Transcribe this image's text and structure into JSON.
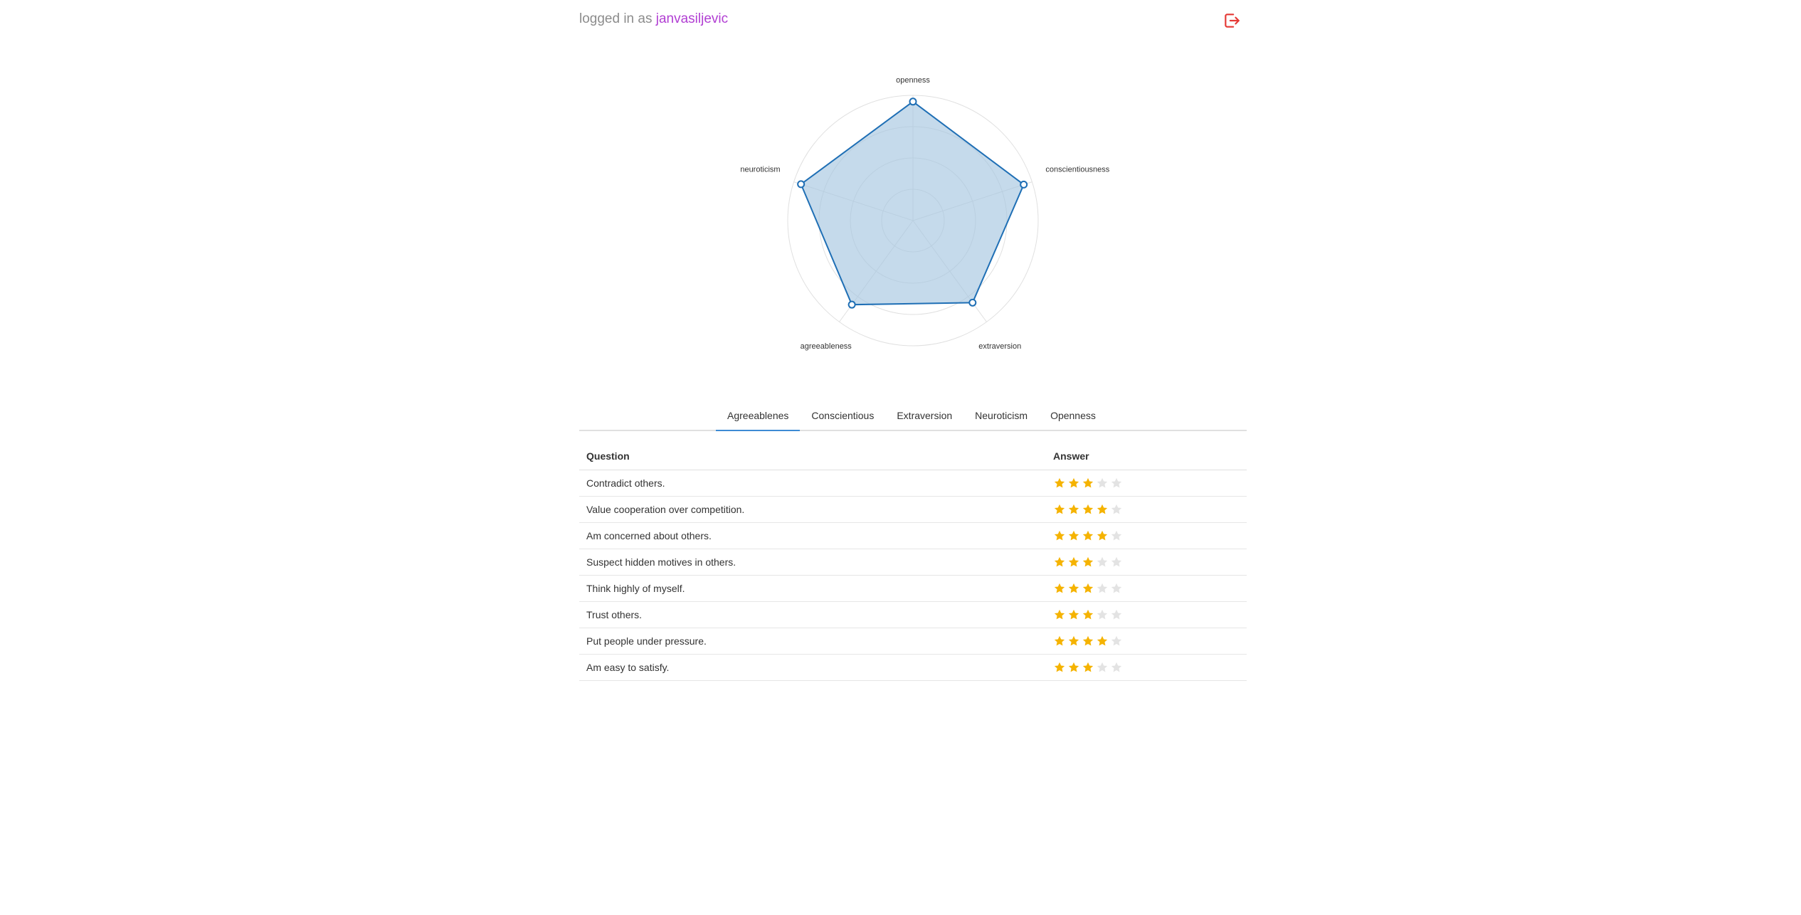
{
  "header": {
    "login_prefix": "logged in as",
    "username": "janvasiljevic",
    "logout_icon": "logout-icon"
  },
  "chart_data": {
    "type": "radar",
    "axes": [
      "openness",
      "conscientiousness",
      "extraversion",
      "agreeableness",
      "neuroticism"
    ],
    "series": [
      {
        "values": [
          0.95,
          0.93,
          0.81,
          0.83,
          0.94
        ]
      }
    ],
    "rlim": [
      0,
      1
    ],
    "grid_rings": 4,
    "colors": {
      "line": "#1f6fb5",
      "fill": "#a6c6e0",
      "grid": "#e0e0e0"
    }
  },
  "tabs": [
    {
      "label": "Agreeablenes",
      "active": true
    },
    {
      "label": "Conscientious",
      "active": false
    },
    {
      "label": "Extraversion",
      "active": false
    },
    {
      "label": "Neuroticism",
      "active": false
    },
    {
      "label": "Openness",
      "active": false
    }
  ],
  "table": {
    "headers": {
      "question": "Question",
      "answer": "Answer"
    },
    "max_stars": 5,
    "rows": [
      {
        "question": "Contradict others.",
        "rating": 3
      },
      {
        "question": "Value cooperation over competition.",
        "rating": 4
      },
      {
        "question": "Am concerned about others.",
        "rating": 4
      },
      {
        "question": "Suspect hidden motives in others.",
        "rating": 3
      },
      {
        "question": "Think highly of myself.",
        "rating": 3
      },
      {
        "question": "Trust others.",
        "rating": 3
      },
      {
        "question": "Put people under pressure.",
        "rating": 4
      },
      {
        "question": "Am easy to satisfy.",
        "rating": 3
      }
    ]
  },
  "colors": {
    "star_filled": "#f5b301",
    "star_empty": "#e3e3e3",
    "accent": "#3d8bd4",
    "username": "#b13ed3",
    "logout": "#e53935"
  }
}
